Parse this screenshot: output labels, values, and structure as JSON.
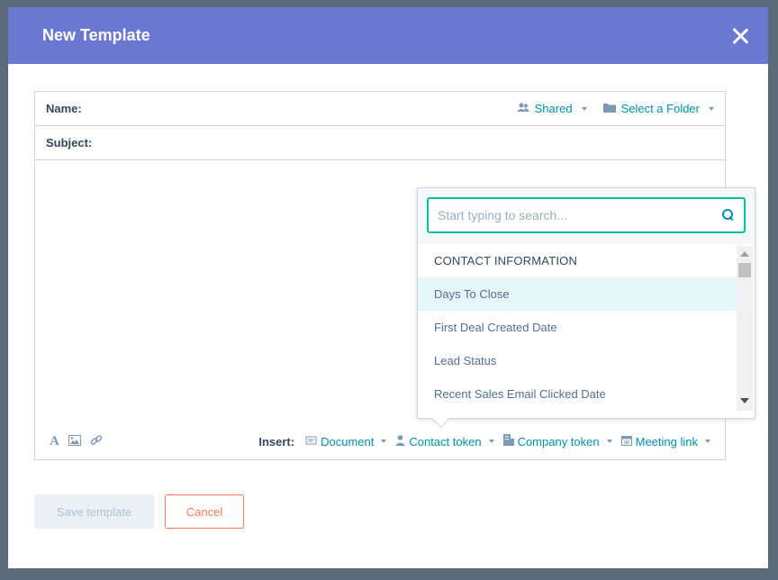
{
  "modal": {
    "title": "New Template"
  },
  "editor": {
    "name_label": "Name:",
    "subject_label": "Subject:",
    "shared_label": "Shared",
    "folder_label": "Select a Folder"
  },
  "toolbar": {
    "insert_label": "Insert:",
    "document_label": "Document",
    "contact_token_label": "Contact token",
    "company_token_label": "Company token",
    "meeting_link_label": "Meeting link"
  },
  "dropdown": {
    "search_placeholder": "Start typing to search...",
    "section_header": "CONTACT INFORMATION",
    "items": [
      {
        "label": "Days To Close"
      },
      {
        "label": "First Deal Created Date"
      },
      {
        "label": "Lead Status"
      },
      {
        "label": "Recent Sales Email Clicked Date"
      }
    ]
  },
  "footer": {
    "save_label": "Save template",
    "cancel_label": "Cancel"
  },
  "colors": {
    "header_bg": "#6a78d1",
    "link": "#0091ae",
    "accent_teal": "#00bda5",
    "cancel_orange": "#ff7a59"
  }
}
